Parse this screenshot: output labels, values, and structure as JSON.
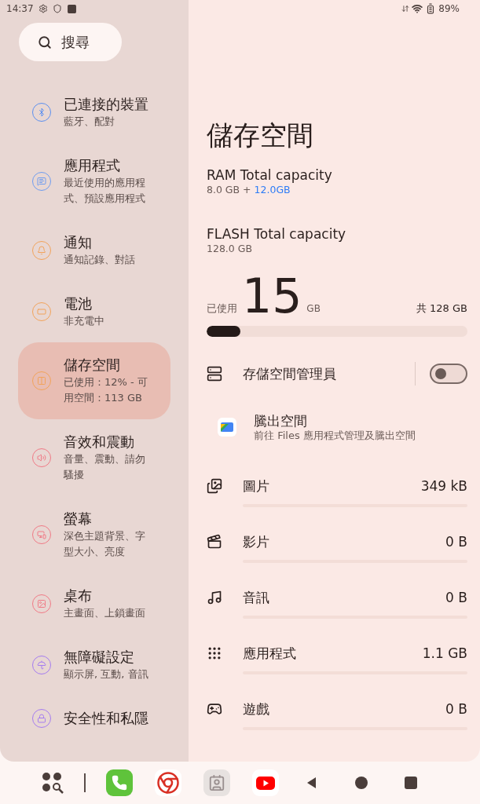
{
  "status_bar": {
    "time": "14:37",
    "battery": "89%"
  },
  "search": {
    "placeholder": "搜尋"
  },
  "sidebar": {
    "items": [
      {
        "title": "已連接的裝置",
        "subtitle": "藍牙、配對",
        "color": "#5b8ff0",
        "selected": false
      },
      {
        "title": "應用程式",
        "subtitle": "最近使用的應用程式、預設應用程式",
        "color": "#6e9cf0",
        "selected": false
      },
      {
        "title": "通知",
        "subtitle": "通知記錄、對話",
        "color": "#f2a35a",
        "selected": false
      },
      {
        "title": "電池",
        "subtitle": "非充電中",
        "color": "#f2a35a",
        "selected": false
      },
      {
        "title": "儲存空間",
        "subtitle": "已使用：12% - 可用空間：113 GB",
        "color": "#f2a35a",
        "selected": true
      },
      {
        "title": "音效和震動",
        "subtitle": "音量、震動、請勿騷擾",
        "color": "#f07a86",
        "selected": false
      },
      {
        "title": "螢幕",
        "subtitle": "深色主題背景、字型大小、亮度",
        "color": "#f07a86",
        "selected": false
      },
      {
        "title": "桌布",
        "subtitle": "主畫面、上鎖畫面",
        "color": "#f07a86",
        "selected": false
      },
      {
        "title": "無障礙設定",
        "subtitle": "顯示屏, 互動, 音訊",
        "color": "#a57cf0",
        "selected": false
      },
      {
        "title": "安全性和私隱",
        "color": "#a57cf0",
        "selected": false
      }
    ]
  },
  "page": {
    "title": "儲存空間",
    "ram": {
      "label": "RAM Total capacity",
      "base": "8.0 GB +",
      "extra": "12.0GB"
    },
    "flash": {
      "label": "FLASH Total capacity",
      "value": "128.0 GB"
    },
    "usage": {
      "prefix": "已使用",
      "amount": "15",
      "unit": "GB",
      "total": "共 128 GB",
      "level": 0.13
    },
    "manager": {
      "label": "存儲空間管理員",
      "on": false
    },
    "free_up": {
      "title": "騰出空間",
      "subtitle": "前往 Files 應用程式管理及騰出空間"
    },
    "categories": [
      {
        "name": "圖片",
        "size": "349 kB"
      },
      {
        "name": "影片",
        "size": "0 B"
      },
      {
        "name": "音訊",
        "size": "0 B"
      },
      {
        "name": "應用程式",
        "size": "1.1 GB"
      },
      {
        "name": "遊戲",
        "size": "0 B"
      }
    ]
  }
}
